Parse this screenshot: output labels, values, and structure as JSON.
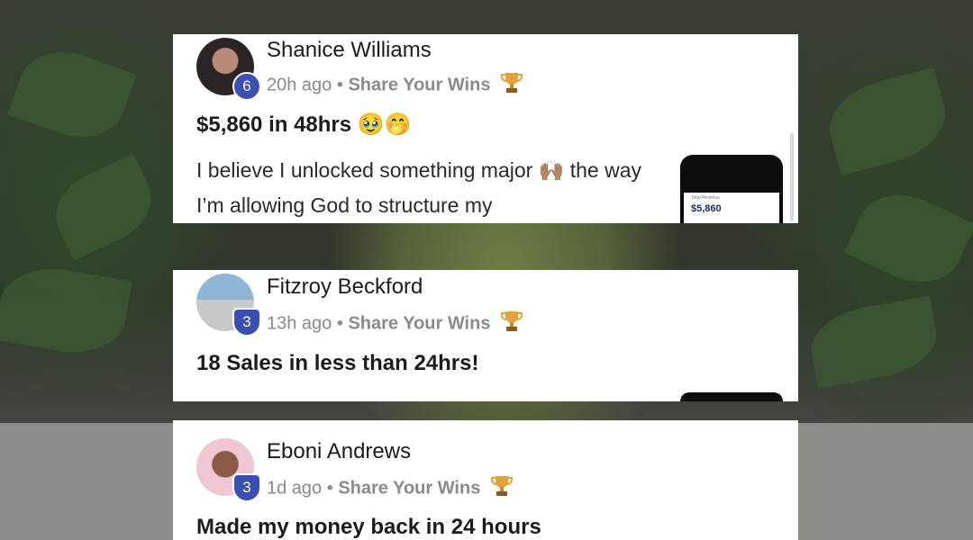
{
  "posts": [
    {
      "author": "Shanice Williams",
      "level": "6",
      "time": "20h ago",
      "separator": "•",
      "category": "Share Your Wins",
      "title": "$5,860 in 48hrs 🥹🤭",
      "body": "I believe I unlocked something major 🙌🏽 the way I’m allowing God to structure my",
      "thumbnail": {
        "amount": "$5,860"
      },
      "avatar_color": "#3a2e2e"
    },
    {
      "author": "Fitzroy Beckford",
      "level": "3",
      "time": "13h ago",
      "separator": "•",
      "category": "Share Your Wins",
      "title": "18 Sales in less than 24hrs!",
      "avatar_color": "#3c6b8a"
    },
    {
      "author": "Eboni Andrews",
      "level": "3",
      "time": "1d ago",
      "separator": "•",
      "category": "Share Your Wins",
      "title": "Made my money back in 24 hours",
      "avatar_color": "#6b4a3a"
    }
  ],
  "icons": {
    "category_icon": "trophy-icon"
  },
  "colors": {
    "level_badge": "#3b4fb3",
    "meta_text": "#8a8a8a",
    "card_bg": "#ffffff"
  }
}
